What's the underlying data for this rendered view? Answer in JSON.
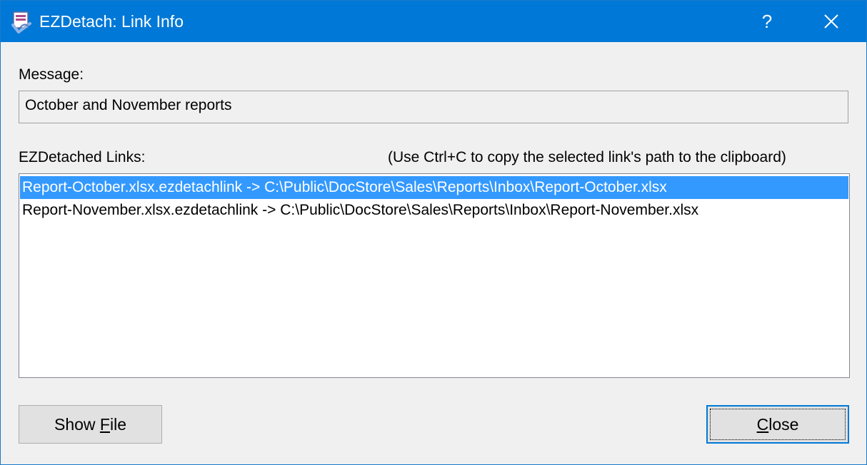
{
  "window": {
    "title": "EZDetach: Link Info",
    "help_label": "?"
  },
  "message": {
    "label": "Message:",
    "value": "October and November reports"
  },
  "links": {
    "label": "EZDetached Links:",
    "hint": "(Use Ctrl+C to copy the selected link's path to the clipboard)",
    "items": [
      {
        "text": "Report-October.xlsx.ezdetachlink -> C:\\Public\\DocStore\\Sales\\Reports\\Inbox\\Report-October.xlsx",
        "selected": true
      },
      {
        "text": "Report-November.xlsx.ezdetachlink -> C:\\Public\\DocStore\\Sales\\Reports\\Inbox\\Report-November.xlsx",
        "selected": false
      }
    ]
  },
  "buttons": {
    "show_file_pre": "Show ",
    "show_file_accel": "F",
    "show_file_post": "ile",
    "close_accel": "C",
    "close_post": "lose"
  },
  "colors": {
    "titlebar": "#0078d7",
    "selection": "#3399ff"
  },
  "icons": {
    "app": "ezdetach-app-icon",
    "close": "close-icon"
  }
}
